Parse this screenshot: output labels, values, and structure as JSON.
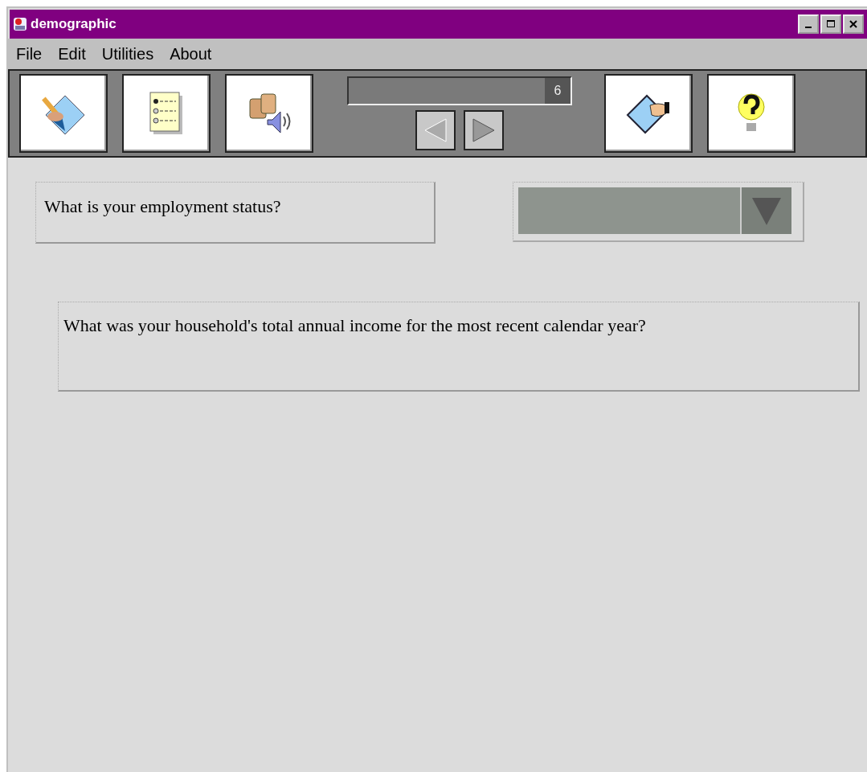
{
  "window": {
    "title": "demographic"
  },
  "menu": [
    "File",
    "Edit",
    "Utilities",
    "About"
  ],
  "toolbar": {
    "page_number": "6"
  },
  "questions": [
    {
      "kind": "dropdown",
      "text": "What is your employment status?"
    },
    {
      "kind": "open",
      "text": "What was your household's total annual income for the most recent calendar year?"
    }
  ]
}
